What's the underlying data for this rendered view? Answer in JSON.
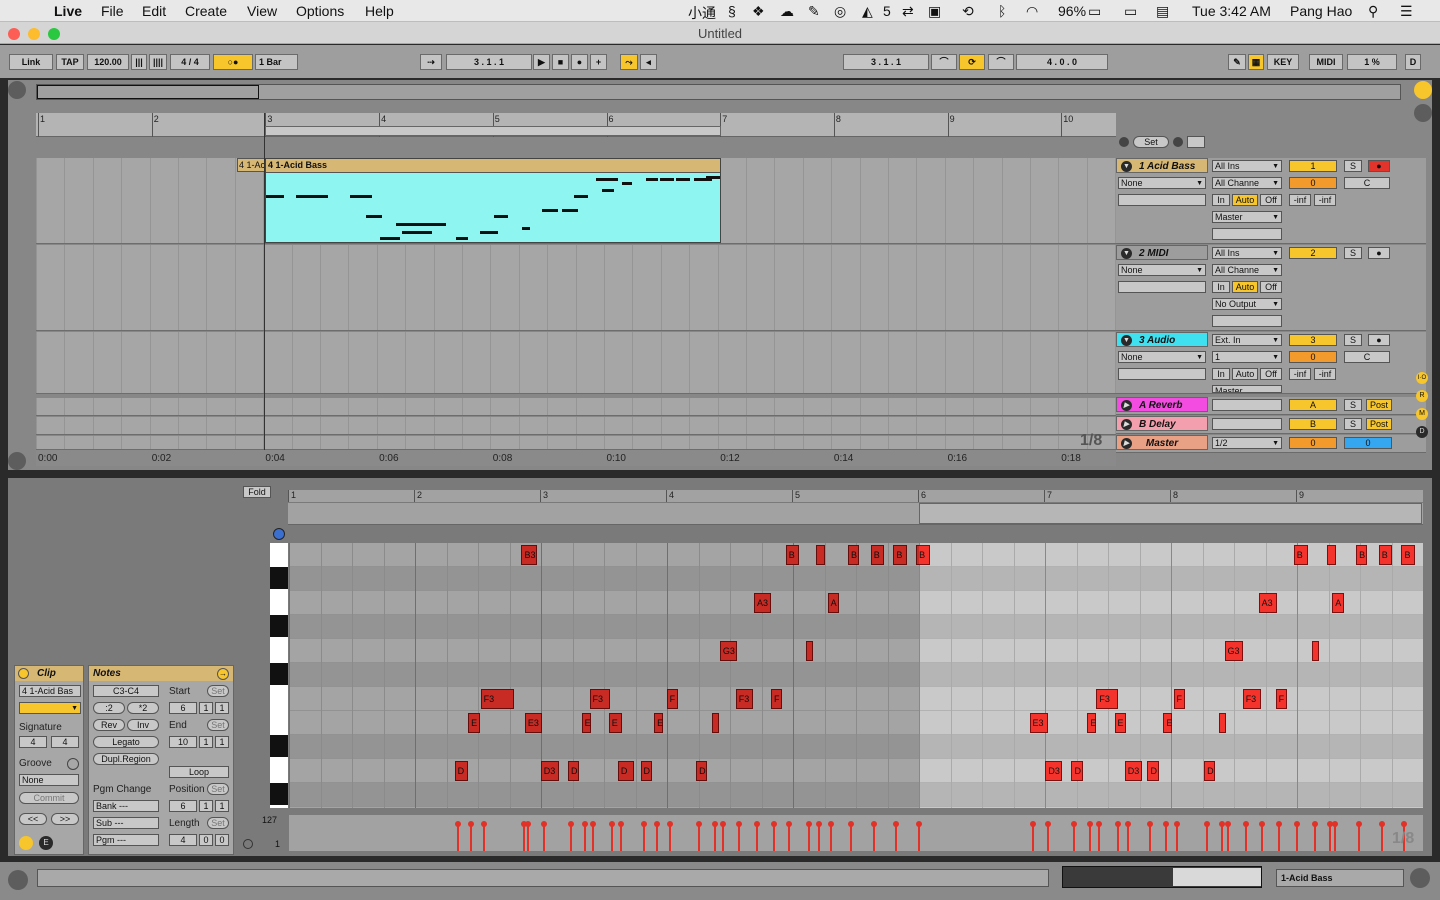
{
  "menubar": {
    "app": "Live",
    "items": [
      "File",
      "Edit",
      "Create",
      "View",
      "Options",
      "Help"
    ],
    "status_extras": [
      "小通",
      "5",
      "96%"
    ],
    "clock": "Tue 3:42 AM",
    "user": "Pang Hao"
  },
  "window": {
    "title": "Untitled"
  },
  "control_bar": {
    "link": "Link",
    "tap": "TAP",
    "tempo": "120.00",
    "signature": "4 / 4",
    "quantize": "1 Bar",
    "position": "3 .   1 .   1",
    "loop_start": "3 .   1 .   1",
    "loop_length": "4 .   0 .   0",
    "key": "KEY",
    "midi": "MIDI",
    "cpu": "1 %",
    "d": "D"
  },
  "arrangement": {
    "ruler_bars": [
      "1",
      "2",
      "3",
      "4",
      "5",
      "6",
      "7",
      "8",
      "9",
      "10"
    ],
    "time_labels": [
      "0:00",
      "0:02",
      "0:04",
      "0:06",
      "0:08",
      "0:10",
      "0:12",
      "0:14",
      "0:16",
      "0:18"
    ],
    "quantization": "1/8",
    "clip_name": "4 1-Acid Bass",
    "clip_ghost_name": "4 1-Aci",
    "set_button": "Set"
  },
  "tracks": [
    {
      "name": "1 Acid Bass",
      "color": "#d7b774",
      "input_type": "All Ins",
      "input_channel": "All Channe",
      "in": "In",
      "auto": "Auto",
      "off": "Off",
      "output": "Master",
      "none": "None",
      "number": "1",
      "vol": "0",
      "pan": "C",
      "inf_l": "-inf",
      "inf_r": "-inf",
      "solo": "S"
    },
    {
      "name": "2 MIDI",
      "color": "#f7e58a",
      "input_type": "All Ins",
      "input_channel": "All Channe",
      "in": "In",
      "auto": "Auto",
      "off": "Off",
      "output": "No Output",
      "none": "None",
      "number": "2",
      "solo": "S"
    },
    {
      "name": "3 Audio",
      "color": "#3fe0f0",
      "input_type": "Ext. In",
      "input_channel": "1",
      "in": "In",
      "auto": "Auto",
      "off": "Off",
      "output": "Master",
      "none": "None",
      "number": "3",
      "vol": "0",
      "pan": "C",
      "inf_l": "-inf",
      "inf_r": "-inf",
      "solo": "S"
    }
  ],
  "returns": [
    {
      "name": "A Reverb",
      "color": "#f24de0",
      "letter": "A",
      "solo": "S",
      "post": "Post"
    },
    {
      "name": "B Delay",
      "color": "#f49fae",
      "letter": "B",
      "solo": "S",
      "post": "Post"
    }
  ],
  "master": {
    "name": "Master",
    "color": "#e8a184",
    "output": "1/2",
    "vol": "0",
    "pan": "0"
  },
  "clip_panel": {
    "title": "Clip",
    "name": "4 1-Acid Bas",
    "signature_label": "Signature",
    "sig_num": "4",
    "sig_den": "4",
    "groove_label": "Groove",
    "groove_value": "None",
    "commit": "Commit",
    "nav_left": "<<",
    "nav_right": ">>"
  },
  "notes_panel": {
    "title": "Notes",
    "range": "C3-C4",
    "half": ":2",
    "double": "*2",
    "rev": "Rev",
    "inv": "Inv",
    "legato": "Legato",
    "dupl": "Dupl.Region",
    "pgm_change": "Pgm Change",
    "bank": "Bank ---",
    "sub": "Sub ---",
    "pgm": "Pgm ---",
    "start_label": "Start",
    "start": [
      "6",
      "1",
      "1"
    ],
    "end_label": "End",
    "end": [
      "10",
      "1",
      "1"
    ],
    "loop": "Loop",
    "position_label": "Position",
    "position": [
      "6",
      "1",
      "1"
    ],
    "length_label": "Length",
    "length": [
      "4",
      "0",
      "0"
    ],
    "set": "Set"
  },
  "editor": {
    "fold": "Fold",
    "ruler_bars": [
      "1",
      "2",
      "3",
      "4",
      "5",
      "6",
      "7",
      "8",
      "9"
    ],
    "vel_max": "127",
    "vel_min": "1",
    "quantization": "1/8",
    "notes": [
      {
        "label": "B3",
        "row": 0,
        "start": 0.205,
        "len": 0.014
      },
      {
        "label": "B",
        "row": 0,
        "start": 0.438,
        "len": 0.012
      },
      {
        "label": "",
        "row": 0,
        "start": 0.465,
        "len": 0.008
      },
      {
        "label": "B",
        "row": 0,
        "start": 0.493,
        "len": 0.01
      },
      {
        "label": "B",
        "row": 0,
        "start": 0.513,
        "len": 0.012
      },
      {
        "label": "B",
        "row": 0,
        "start": 0.533,
        "len": 0.012
      },
      {
        "label": "B",
        "row": 0,
        "start": 0.553,
        "len": 0.012
      },
      {
        "label": "B",
        "row": 0,
        "start": 0.886,
        "len": 0.013
      },
      {
        "label": "",
        "row": 0,
        "start": 0.915,
        "len": 0.008
      },
      {
        "label": "B",
        "row": 0,
        "start": 0.941,
        "len": 0.01
      },
      {
        "label": "B",
        "row": 0,
        "start": 0.961,
        "len": 0.012
      },
      {
        "label": "B",
        "row": 0,
        "start": 0.981,
        "len": 0.012
      },
      {
        "label": "A3",
        "row": 2,
        "start": 0.41,
        "len": 0.015
      },
      {
        "label": "A",
        "row": 2,
        "start": 0.475,
        "len": 0.01
      },
      {
        "label": "A3",
        "row": 2,
        "start": 0.855,
        "len": 0.016
      },
      {
        "label": "A",
        "row": 2,
        "start": 0.92,
        "len": 0.01
      },
      {
        "label": "G3",
        "row": 4,
        "start": 0.38,
        "len": 0.015
      },
      {
        "label": "",
        "row": 4,
        "start": 0.456,
        "len": 0.006
      },
      {
        "label": "G3",
        "row": 4,
        "start": 0.825,
        "len": 0.016
      },
      {
        "label": "",
        "row": 4,
        "start": 0.902,
        "len": 0.006
      },
      {
        "label": "F3",
        "row": 6,
        "start": 0.169,
        "len": 0.029
      },
      {
        "label": "F3",
        "row": 6,
        "start": 0.265,
        "len": 0.018
      },
      {
        "label": "F",
        "row": 6,
        "start": 0.333,
        "len": 0.01
      },
      {
        "label": "F3",
        "row": 6,
        "start": 0.394,
        "len": 0.015
      },
      {
        "label": "F",
        "row": 6,
        "start": 0.425,
        "len": 0.01
      },
      {
        "label": "F3",
        "row": 6,
        "start": 0.712,
        "len": 0.019
      },
      {
        "label": "F",
        "row": 6,
        "start": 0.78,
        "len": 0.01
      },
      {
        "label": "F3",
        "row": 6,
        "start": 0.841,
        "len": 0.016
      },
      {
        "label": "F",
        "row": 6,
        "start": 0.87,
        "len": 0.01
      },
      {
        "label": "E",
        "row": 7,
        "start": 0.158,
        "len": 0.01
      },
      {
        "label": "E3",
        "row": 7,
        "start": 0.208,
        "len": 0.015
      },
      {
        "label": "E",
        "row": 7,
        "start": 0.258,
        "len": 0.008
      },
      {
        "label": "E",
        "row": 7,
        "start": 0.282,
        "len": 0.012
      },
      {
        "label": "E",
        "row": 7,
        "start": 0.322,
        "len": 0.008
      },
      {
        "label": "",
        "row": 7,
        "start": 0.373,
        "len": 0.006
      },
      {
        "label": "E3",
        "row": 7,
        "start": 0.653,
        "len": 0.016
      },
      {
        "label": "E",
        "row": 7,
        "start": 0.704,
        "len": 0.008
      },
      {
        "label": "E",
        "row": 7,
        "start": 0.728,
        "len": 0.01
      },
      {
        "label": "E",
        "row": 7,
        "start": 0.771,
        "len": 0.008
      },
      {
        "label": "",
        "row": 7,
        "start": 0.82,
        "len": 0.006
      },
      {
        "label": "D",
        "row": 9,
        "start": 0.146,
        "len": 0.012
      },
      {
        "label": "D3",
        "row": 9,
        "start": 0.222,
        "len": 0.016
      },
      {
        "label": "D",
        "row": 9,
        "start": 0.246,
        "len": 0.01
      },
      {
        "label": "D",
        "row": 9,
        "start": 0.29,
        "len": 0.014
      },
      {
        "label": "D",
        "row": 9,
        "start": 0.31,
        "len": 0.01
      },
      {
        "label": "D",
        "row": 9,
        "start": 0.359,
        "len": 0.01
      },
      {
        "label": "D3",
        "row": 9,
        "start": 0.667,
        "len": 0.015
      },
      {
        "label": "D",
        "row": 9,
        "start": 0.69,
        "len": 0.01
      },
      {
        "label": "D3",
        "row": 9,
        "start": 0.737,
        "len": 0.015
      },
      {
        "label": "D",
        "row": 9,
        "start": 0.757,
        "len": 0.01
      },
      {
        "label": "D",
        "row": 9,
        "start": 0.807,
        "len": 0.01
      }
    ]
  },
  "status_bar": {
    "track_name": "1-Acid Bass"
  }
}
